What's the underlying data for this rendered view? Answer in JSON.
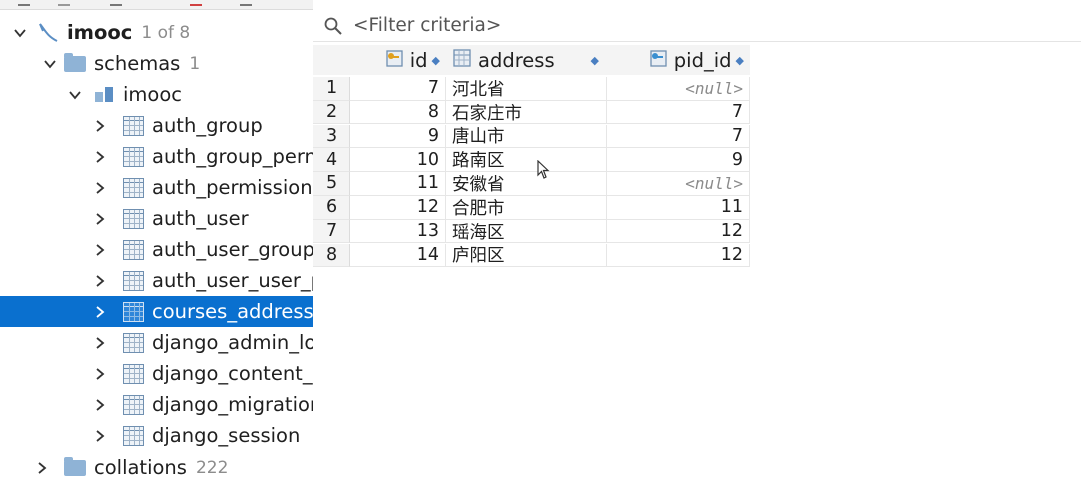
{
  "tree": {
    "root": {
      "label": "imooc",
      "count": "1 of 8"
    },
    "schemas": {
      "label": "schemas",
      "count": "1"
    },
    "schema": {
      "label": "imooc"
    },
    "tables": [
      "auth_group",
      "auth_group_perm",
      "auth_permission",
      "auth_user",
      "auth_user_groups",
      "auth_user_user_pe",
      "courses_addressi",
      "django_admin_log",
      "django_content_ty",
      "django_migration",
      "django_session"
    ],
    "selected_table_index": 6,
    "collations": {
      "label": "collations",
      "count": "222"
    }
  },
  "filter": {
    "placeholder": "<Filter criteria>"
  },
  "grid": {
    "columns": [
      "id",
      "address",
      "pid_id"
    ],
    "rows": [
      {
        "n": "1",
        "id": "7",
        "address": "河北省",
        "pid_id": "<null>"
      },
      {
        "n": "2",
        "id": "8",
        "address": "石家庄市",
        "pid_id": "7"
      },
      {
        "n": "3",
        "id": "9",
        "address": "唐山市",
        "pid_id": "7"
      },
      {
        "n": "4",
        "id": "10",
        "address": "路南区",
        "pid_id": "9"
      },
      {
        "n": "5",
        "id": "11",
        "address": "安徽省",
        "pid_id": "<null>"
      },
      {
        "n": "6",
        "id": "12",
        "address": "合肥市",
        "pid_id": "11"
      },
      {
        "n": "7",
        "id": "13",
        "address": "瑶海区",
        "pid_id": "12"
      },
      {
        "n": "8",
        "id": "14",
        "address": "庐阳区",
        "pid_id": "12"
      }
    ]
  },
  "colors": {
    "selection": "#0a70cf",
    "muted": "#8c8c8c",
    "null_text": "#8a8a8a"
  },
  "icons": [
    "chevron-down-icon",
    "chevron-right-icon",
    "database-icon",
    "folder-icon",
    "schema-icon",
    "table-icon",
    "search-icon",
    "key-column-icon",
    "column-icon",
    "foreign-key-column-icon",
    "mouse-cursor-icon"
  ]
}
